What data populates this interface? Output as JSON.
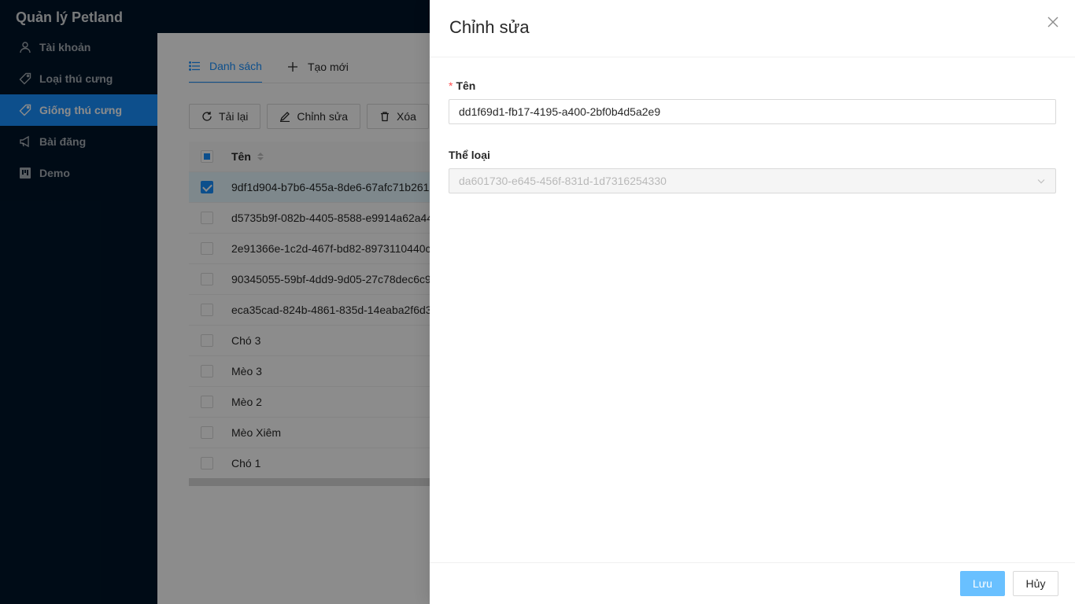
{
  "app": {
    "title": "Quản lý Petland"
  },
  "sidebar": {
    "items": [
      {
        "label": "Tài khoản",
        "icon": "user-icon",
        "active": false
      },
      {
        "label": "Loại thú cưng",
        "icon": "tag-icon",
        "active": false
      },
      {
        "label": "Giống thú cưng",
        "icon": "tag-icon",
        "active": true
      },
      {
        "label": "Bài đăng",
        "icon": "notification-icon",
        "active": false
      },
      {
        "label": "Demo",
        "icon": "project-icon",
        "active": false
      }
    ]
  },
  "tabs": [
    {
      "label": "Danh sách",
      "icon": "unordered-list-icon",
      "active": true
    },
    {
      "label": "Tạo mới",
      "icon": "plus-icon",
      "active": false
    }
  ],
  "toolbar": {
    "reload_label": "Tải lại",
    "edit_label": "Chỉnh sửa",
    "delete_label": "Xóa"
  },
  "table": {
    "header_name": "Tên",
    "rows": [
      {
        "name": "9df1d904-b7b6-455a-8de6-67afc71b261",
        "selected": true
      },
      {
        "name": "d5735b9f-082b-4405-8588-e9914a62a44",
        "selected": false
      },
      {
        "name": "2e91366e-1c2d-467f-bd82-8973110440c",
        "selected": false
      },
      {
        "name": "90345055-59bf-4dd9-9d05-27c78dec6c9",
        "selected": false
      },
      {
        "name": "eca35cad-824b-4861-835d-14eaba2f6d3",
        "selected": false
      },
      {
        "name": "Chó 3",
        "selected": false
      },
      {
        "name": "Mèo 3",
        "selected": false
      },
      {
        "name": "Mèo 2",
        "selected": false
      },
      {
        "name": "Mèo Xiêm",
        "selected": false
      },
      {
        "name": "Chó 1",
        "selected": false
      }
    ]
  },
  "drawer": {
    "title": "Chỉnh sửa",
    "name_label": "Tên",
    "name_value": "dd1f69d1-fb17-4195-a400-2bf0b4d5a2e9",
    "type_label": "Thể loại",
    "type_value": "da601730-e645-456f-831d-1d7316254330",
    "save_label": "Lưu",
    "cancel_label": "Hủy"
  },
  "colors": {
    "primary": "#1890ff",
    "sidebar_bg": "#001529",
    "required": "#ff4d4f"
  }
}
